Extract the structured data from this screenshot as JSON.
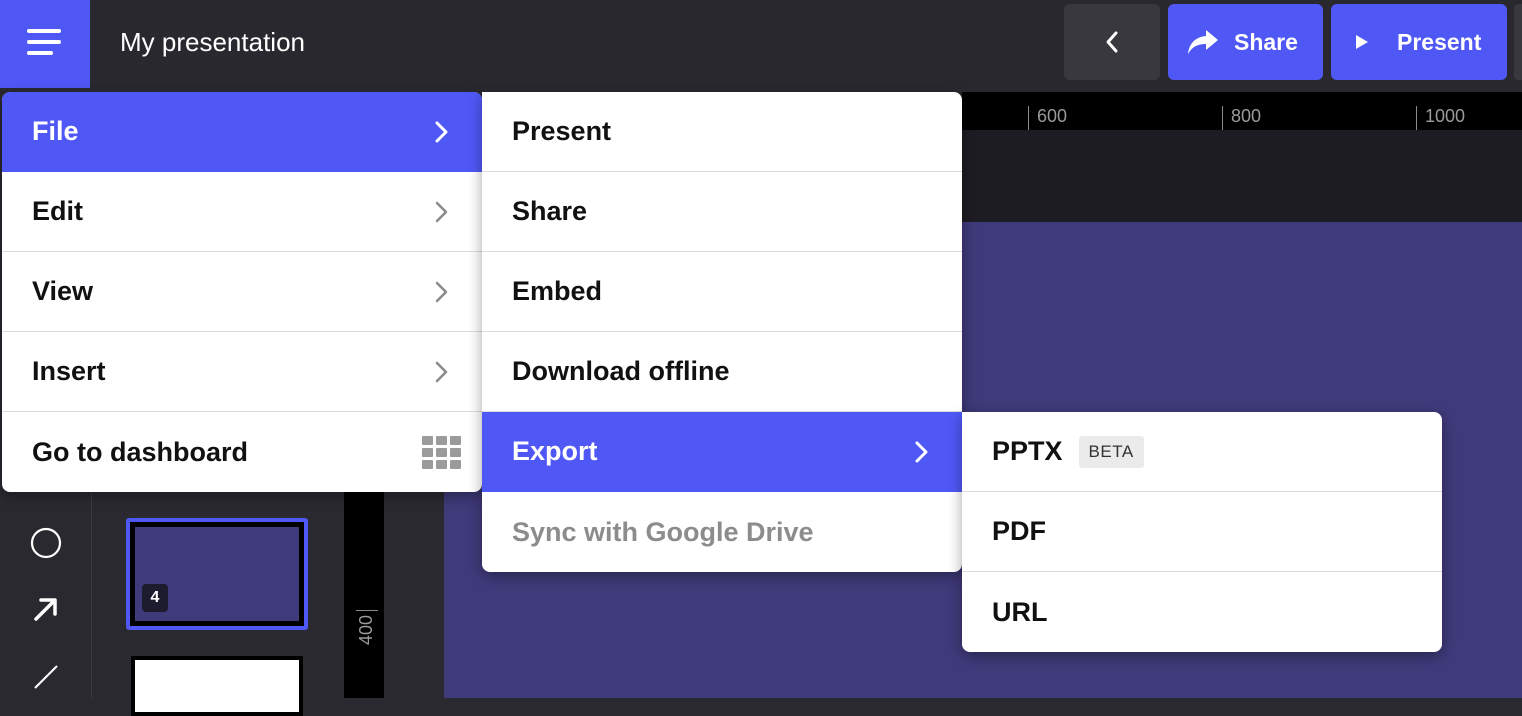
{
  "app": {
    "title": "My presentation"
  },
  "topbar": {
    "share_label": "Share",
    "present_label": "Present"
  },
  "ruler": {
    "top_ticks": [
      "600",
      "800",
      "1000"
    ],
    "left_tick": "400"
  },
  "slides": {
    "current_number": "4"
  },
  "main_menu": {
    "items": [
      {
        "label": "File"
      },
      {
        "label": "Edit"
      },
      {
        "label": "View"
      },
      {
        "label": "Insert"
      },
      {
        "label": "Go to dashboard"
      }
    ]
  },
  "file_menu": {
    "items": [
      {
        "label": "Present"
      },
      {
        "label": "Share"
      },
      {
        "label": "Embed"
      },
      {
        "label": "Download offline"
      },
      {
        "label": "Export"
      },
      {
        "label": "Sync with Google Drive"
      }
    ]
  },
  "export_menu": {
    "items": [
      {
        "label": "PPTX",
        "badge": "BETA"
      },
      {
        "label": "PDF"
      },
      {
        "label": "URL"
      }
    ]
  },
  "colors": {
    "accent": "#4f58f5",
    "topbar": "#29282e",
    "slide": "#3f3a7a"
  }
}
